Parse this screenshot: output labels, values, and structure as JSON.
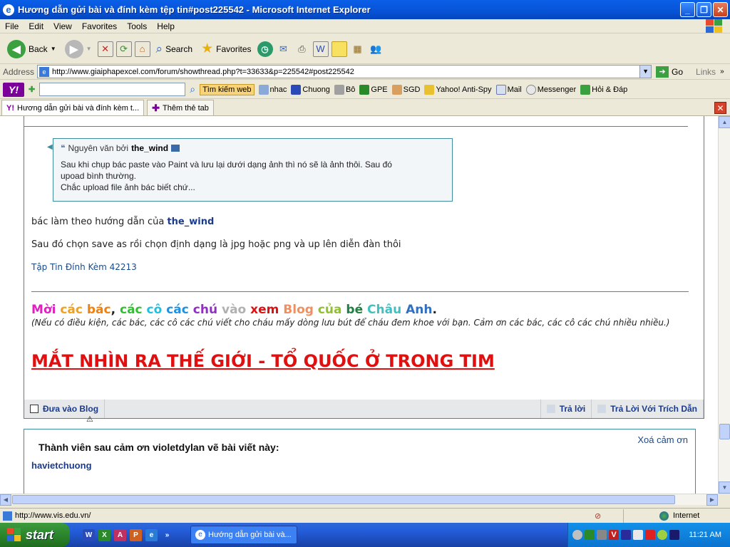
{
  "window": {
    "title": "Hư­ơng dẫn gửi bài và đính kèm tệp tin#post225542 - Microsoft Internet Explorer"
  },
  "menu": [
    "File",
    "Edit",
    "View",
    "Favorites",
    "Tools",
    "Help"
  ],
  "toolbar": {
    "back": "Back",
    "search": "Search",
    "favorites": "Favorites"
  },
  "address": {
    "label": "Address",
    "url": "http://www.giaiphapexcel.com/forum/showthread.php?t=33633&p=225542#post225542",
    "go": "Go",
    "links": "Links"
  },
  "yahoo": {
    "search_btn": "Tìm kiếm web",
    "items": [
      "nhac",
      "Chuong",
      "Bô",
      "GPE",
      "SGD",
      "Yahoo! Anti-Spy",
      "Mail",
      "Messenger",
      "Hỏi & Đáp"
    ]
  },
  "tabs": {
    "active": "Hư­ơng dẫn gửi bài và đính kèm t...",
    "new_tab": "Thêm thẻ tab"
  },
  "post": {
    "quote_header_prefix": "Nguyên văn bởi",
    "quote_author": "the_wind",
    "quote_line1": "Sau khi chụp bác paste vào Paint và lưu lại dưới dạng ảnh thì nó sẽ là ảnh thôi. Sau đó",
    "quote_line2": "upoad bình thường.",
    "quote_line3": "Chắc upload file ảnh bác biết chứ...",
    "line1_prefix": "bác làm theo hướng dẫn của",
    "line1_author": "the_wind",
    "line2": "Sau đó chọn save as rồi chọn định dạng là jpg hoặc png và up lên diễn đàn thôi",
    "attachment": "Tập Tin Đính Kèm 42213",
    "sig_words": [
      {
        "t": "Mời ",
        "c": "#e020c0"
      },
      {
        "t": "các ",
        "c": "#f0a020"
      },
      {
        "t": "bác",
        "c": "#f08010"
      },
      {
        "t": ", ",
        "c": "#222222"
      },
      {
        "t": "các ",
        "c": "#30c030"
      },
      {
        "t": "cô ",
        "c": "#20c0e0"
      },
      {
        "t": "các ",
        "c": "#2090e0"
      },
      {
        "t": "chú ",
        "c": "#9030c0"
      },
      {
        "t": "vào ",
        "c": "#b0b0b0"
      },
      {
        "t": "xem ",
        "c": "#e01010"
      },
      {
        "t": "Blog ",
        "c": "#f09060"
      },
      {
        "t": "của ",
        "c": "#90c030"
      },
      {
        "t": "bé ",
        "c": "#208040"
      },
      {
        "t": "Châu ",
        "c": "#40c0c0"
      },
      {
        "t": "Anh",
        "c": "#3070c0"
      },
      {
        "t": ".",
        "c": "#222222"
      }
    ],
    "sig_line2": "(Nếu có điều kiện, các bác, các cô các chú viết cho cháu mấy dòng lưu bút để cháu đem khoe với bạn. Cảm ơn các bác, các cô các chú nhiều nhiều.)",
    "sig_line3": "MẮT NHÌN RA THẾ GIỚI - TỔ QUỐC Ở TRONG TIM",
    "blog_btn": "Đưa vào Blog",
    "reply_btn": "Trả lời",
    "quote_reply_btn": "Trả Lời Với Trích Dẫn"
  },
  "thanks": {
    "header": "Thành viên sau cảm ơn violetdylan vẽ bài viết này:",
    "remove": "Xoá cảm ơn",
    "user": "havietchuong"
  },
  "status": {
    "url": "http://www.vis.edu.vn/",
    "zone": "Internet"
  },
  "taskbar": {
    "start": "start",
    "task": "Hướng dẫn gửi bài và...",
    "clock": "11:21 AM"
  }
}
